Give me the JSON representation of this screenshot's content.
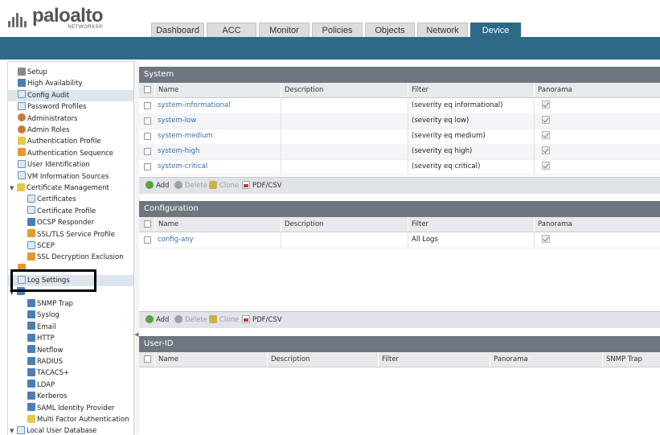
{
  "brand": {
    "name": "paloalto",
    "sub": "NETWORKS®"
  },
  "tabs": [
    {
      "label": "Dashboard",
      "w": 66
    },
    {
      "label": "ACC",
      "w": 62
    },
    {
      "label": "Monitor",
      "w": 63
    },
    {
      "label": "Policies",
      "w": 63
    },
    {
      "label": "Objects",
      "w": 62
    },
    {
      "label": "Network",
      "w": 63
    },
    {
      "label": "Device",
      "w": 63
    }
  ],
  "active_tab": "Device",
  "tree": [
    {
      "label": "Setup",
      "indent": 0,
      "icon": "gear-icon",
      "color": "grey"
    },
    {
      "label": "High Availability",
      "indent": 0,
      "icon": "ha-icon",
      "color": "blue"
    },
    {
      "label": "Config Audit",
      "indent": 0,
      "icon": "audit-icon",
      "color": "doc",
      "selected": true
    },
    {
      "label": "Password Profiles",
      "indent": 0,
      "icon": "password-icon",
      "color": "doc"
    },
    {
      "label": "Administrators",
      "indent": 0,
      "icon": "admin-icon",
      "color": "person"
    },
    {
      "label": "Admin Roles",
      "indent": 0,
      "icon": "role-icon",
      "color": "person"
    },
    {
      "label": "Authentication Profile",
      "indent": 0,
      "icon": "auth-profile-icon",
      "color": "yellow"
    },
    {
      "label": "Authentication Sequence",
      "indent": 0,
      "icon": "auth-sequence-icon",
      "color": "orange"
    },
    {
      "label": "User Identification",
      "indent": 0,
      "icon": "user-id-icon",
      "color": "doc"
    },
    {
      "label": "VM Information Sources",
      "indent": 0,
      "icon": "vm-icon",
      "color": "doc"
    },
    {
      "label": "Certificate Management",
      "indent": 0,
      "icon": "cert-mgmt-icon",
      "color": "yellow",
      "expanded": true
    },
    {
      "label": "Certificates",
      "indent": 1,
      "icon": "certificate-icon",
      "color": "doc"
    },
    {
      "label": "Certificate Profile",
      "indent": 1,
      "icon": "cert-profile-icon",
      "color": "doc"
    },
    {
      "label": "OCSP Responder",
      "indent": 1,
      "icon": "ocsp-icon",
      "color": "blue"
    },
    {
      "label": "SSL/TLS Service Profile",
      "indent": 1,
      "icon": "lock-icon",
      "color": "orange"
    },
    {
      "label": "SCEP",
      "indent": 1,
      "icon": "scep-icon",
      "color": "doc"
    },
    {
      "label": "SSL Decryption Exclusion",
      "indent": 1,
      "icon": "lock-icon",
      "color": "orange"
    },
    {
      "label": "",
      "indent": 0,
      "icon": "response-pages-icon",
      "color": "orange"
    },
    {
      "label": "Log Settings",
      "indent": 0,
      "icon": "log-settings-icon",
      "color": "doc",
      "selected": true
    },
    {
      "label": "",
      "indent": 0,
      "icon": "server-profiles-icon",
      "color": "blue",
      "expanded": true
    },
    {
      "label": "SNMP Trap",
      "indent": 1,
      "icon": "snmp-icon",
      "color": "blue"
    },
    {
      "label": "Syslog",
      "indent": 1,
      "icon": "syslog-icon",
      "color": "blue"
    },
    {
      "label": "Email",
      "indent": 1,
      "icon": "email-icon",
      "color": "blue"
    },
    {
      "label": "HTTP",
      "indent": 1,
      "icon": "http-icon",
      "color": "blue"
    },
    {
      "label": "Netflow",
      "indent": 1,
      "icon": "netflow-icon",
      "color": "blue"
    },
    {
      "label": "RADIUS",
      "indent": 1,
      "icon": "radius-icon",
      "color": "blue"
    },
    {
      "label": "TACACS+",
      "indent": 1,
      "icon": "tacacs-icon",
      "color": "blue"
    },
    {
      "label": "LDAP",
      "indent": 1,
      "icon": "ldap-icon",
      "color": "blue"
    },
    {
      "label": "Kerberos",
      "indent": 1,
      "icon": "kerberos-icon",
      "color": "blue"
    },
    {
      "label": "SAML Identity Provider",
      "indent": 1,
      "icon": "saml-icon",
      "color": "blue"
    },
    {
      "label": "Multi Factor Authentication",
      "indent": 1,
      "icon": "mfa-icon",
      "color": "yellow"
    },
    {
      "label": "Local User Database",
      "indent": 0,
      "icon": "user-db-icon",
      "color": "doc",
      "expanded": true
    }
  ],
  "system": {
    "title": "System",
    "columns": [
      "Name",
      "Description",
      "Filter",
      "Panorama"
    ],
    "rows": [
      {
        "name": "system-informational",
        "description": "",
        "filter": "(severity eq informational)"
      },
      {
        "name": "system-low",
        "description": "",
        "filter": "(severity eq low)"
      },
      {
        "name": "system-medium",
        "description": "",
        "filter": "(severity eq medium)"
      },
      {
        "name": "system-high",
        "description": "",
        "filter": "(severity eq high)"
      },
      {
        "name": "system-critical",
        "description": "",
        "filter": "(severity eq critical)"
      }
    ]
  },
  "configuration": {
    "title": "Configuration",
    "columns": [
      "Name",
      "Description",
      "Filter",
      "Panorama"
    ],
    "rows": [
      {
        "name": "config-any",
        "description": "",
        "filter": "All Logs"
      }
    ]
  },
  "userid": {
    "title": "User-ID",
    "columns": [
      "Name",
      "Description",
      "Filter",
      "Panorama",
      "SNMP Trap"
    ]
  },
  "toolbar": {
    "add": "Add",
    "delete": "Delete",
    "clone": "Clone",
    "pdf": "PDF/CSV"
  }
}
